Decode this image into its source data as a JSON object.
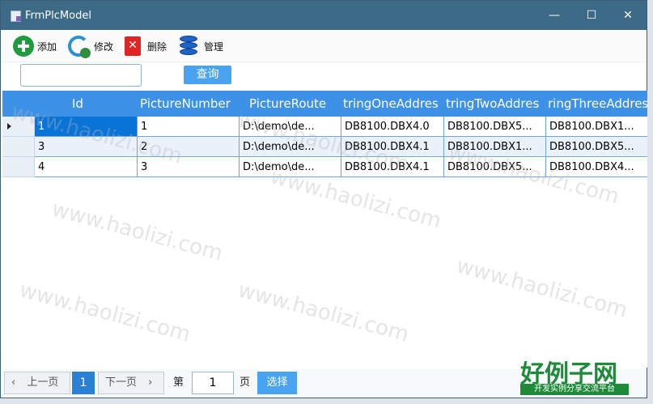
{
  "window": {
    "title": "FrmPlcModel",
    "controls": {
      "minimize": "—",
      "maximize": "☐",
      "close": "✕"
    }
  },
  "toolbar": {
    "items": [
      {
        "label": "添加",
        "icon": "add-icon"
      },
      {
        "label": "修改",
        "icon": "refresh-icon"
      },
      {
        "label": "删除",
        "icon": "delete-icon"
      },
      {
        "label": "管理",
        "icon": "database-icon"
      }
    ]
  },
  "filter": {
    "search_value": "",
    "query_label": "查询"
  },
  "grid": {
    "columns": [
      "Id",
      "PictureNumber",
      "PictureRoute",
      "tringOneAddres",
      "tringTwoAddres",
      "ringThreeAddres"
    ],
    "rows": [
      [
        "1",
        "1",
        "D:\\demo\\de...",
        "DB8100.DBX4.0",
        "DB8100.DBX5...",
        "DB8100.DBX1..."
      ],
      [
        "3",
        "2",
        "D:\\demo\\de...",
        "DB8100.DBX4.1",
        "DB8100.DBX1...",
        "DB8100.DBX5..."
      ],
      [
        "4",
        "3",
        "D:\\demo\\de...",
        "DB8100.DBX4.1",
        "DB8100.DBX5...",
        "DB8100.DBX4..."
      ]
    ]
  },
  "pager": {
    "prev_label": "上一页",
    "current_page": "1",
    "next_label": "下一页",
    "page_prefix": "第",
    "page_input": "1",
    "page_suffix": "页",
    "select_label": "选择"
  },
  "watermark_text": "www.haolizi.com",
  "logo": {
    "main": "好例子网",
    "sub": "开发实例分享交流平台"
  },
  "colors": {
    "titlebar": "#3d6a86",
    "header": "#3d92e8",
    "selection": "#0a74d6",
    "button": "#4aa3f0"
  }
}
